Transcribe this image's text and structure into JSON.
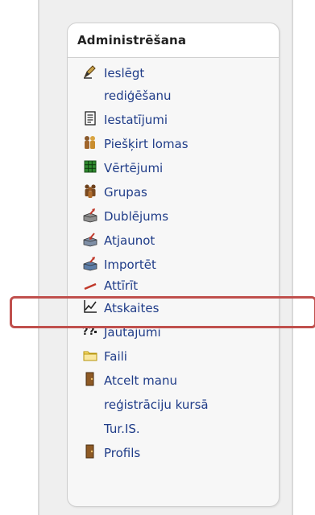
{
  "block": {
    "title": "Administrēšana"
  },
  "items": [
    {
      "label": "Ieslēgt",
      "label2": "rediģēšanu",
      "icon": "edit-icon"
    },
    {
      "label": "Iestatījumi",
      "icon": "settings-document-icon"
    },
    {
      "label": "Piešķirt lomas",
      "icon": "assign-roles-icon"
    },
    {
      "label": "Vērtējumi",
      "icon": "grades-icon"
    },
    {
      "label": "Grupas",
      "icon": "groups-icon"
    },
    {
      "label": "Dublējums",
      "icon": "backup-icon"
    },
    {
      "label": "Atjaunot",
      "icon": "restore-icon"
    },
    {
      "label": "Importēt",
      "icon": "import-icon"
    },
    {
      "label": "Attīrīt",
      "icon": "reset-icon"
    },
    {
      "label": "Atskaites",
      "icon": "reports-icon"
    },
    {
      "label": "Jautājumi",
      "icon": "questions-icon"
    },
    {
      "label": "Faili",
      "icon": "files-folder-icon"
    },
    {
      "label": "Atcelt manu",
      "label2": "reģistrāciju kursā",
      "label3": "Tur.IS.",
      "icon": "unenrol-icon"
    },
    {
      "label": "Profils",
      "icon": "profile-icon"
    }
  ],
  "colors": {
    "link": "#1f3c88",
    "highlight_border": "#c0504d"
  }
}
